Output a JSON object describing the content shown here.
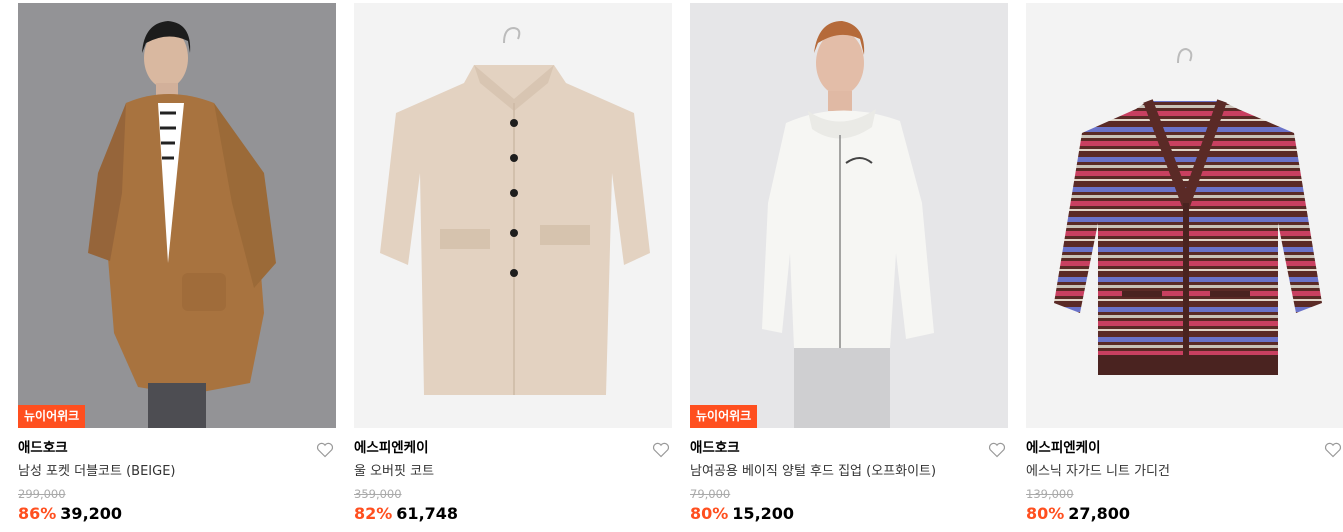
{
  "products": [
    {
      "badge": "뉴이어위크",
      "brand": "애드호크",
      "name": "남성 포켓 더블코트 (BEIGE)",
      "original_price": "299,000",
      "discount": "86%",
      "price": "39,200"
    },
    {
      "badge": "",
      "brand": "에스피엔케이",
      "name": "울 오버핏 코트",
      "original_price": "359,000",
      "discount": "82%",
      "price": "61,748"
    },
    {
      "badge": "뉴이어위크",
      "brand": "애드호크",
      "name": "남여공용 베이직 양털 후드 집업 (오프화이트)",
      "original_price": "79,000",
      "discount": "80%",
      "price": "15,200"
    },
    {
      "badge": "",
      "brand": "에스피엔케이",
      "name": "에스닉 자가드 니트 가디건",
      "original_price": "139,000",
      "discount": "80%",
      "price": "27,800"
    }
  ],
  "colors": {
    "accent": "#ff4f1f",
    "badge_bg": "#ff4f1f",
    "original_price": "#aaaaaa"
  },
  "icons": {
    "wishlist": "heart-outline-icon"
  }
}
